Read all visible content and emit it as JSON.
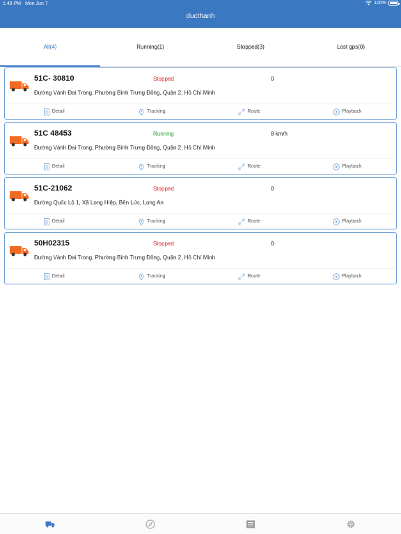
{
  "status_bar": {
    "time": "1:49 PM",
    "date": "Mon Jun 7",
    "battery": "100%"
  },
  "header": {
    "title": "ducthanh"
  },
  "tabs": [
    {
      "label": "All(4)",
      "active": true
    },
    {
      "label": "Running(1)",
      "active": false
    },
    {
      "label": "Stopped(3)",
      "active": false
    },
    {
      "label": "Lost gps(0)",
      "active": false
    }
  ],
  "actions": {
    "detail": "Detail",
    "tracking": "Tracking",
    "route": "Route",
    "playback": "Playback"
  },
  "vehicles": [
    {
      "plate": "51C- 30810",
      "status": "Stopped",
      "speed": "0",
      "address": "Đường Vành Đai Trong, Phường Bình Trưng Đông, Quận 2, Hồ Chí Minh"
    },
    {
      "plate": "51C 48453",
      "status": "Running",
      "speed": "8 km/h",
      "address": "Đường Vành Đai Trong, Phường Bình Trưng Đông, Quận 2, Hồ Chí Minh"
    },
    {
      "plate": "51C-21062",
      "status": "Stopped",
      "speed": "0",
      "address": "Đường Quốc Lộ 1, Xã Long Hiệp, Bến Lức, Long An"
    },
    {
      "plate": "50H02315",
      "status": "Stopped",
      "speed": "0",
      "address": "Đường Vành Đai Trong, Phường Bình Trưng Đông, Quận 2, Hồ Chí Minh"
    }
  ],
  "colors": {
    "header": "#3a78c2",
    "stopped": "#e02020",
    "running": "#2aa02a",
    "truck": "#f26a21",
    "card_border": "#6f9fd6"
  },
  "bottom_nav_icons": [
    "truck-tab-icon",
    "compass-tab-icon",
    "report-tab-icon",
    "settings-tab-icon"
  ]
}
